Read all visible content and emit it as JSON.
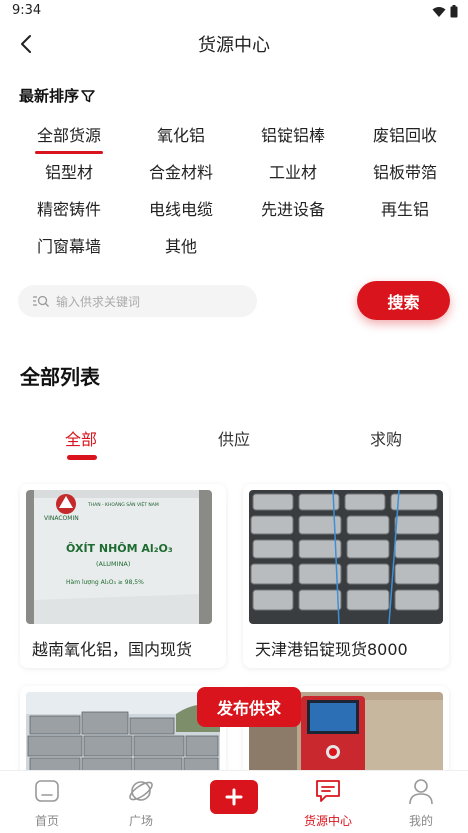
{
  "status_bar": {
    "time": "9:34",
    "icons": [
      "wifi-icon",
      "battery-icon"
    ]
  },
  "header": {
    "title": "货源中心"
  },
  "sort": {
    "label": "最新排序",
    "icon": "filter-icon"
  },
  "categories": [
    {
      "label": "全部货源",
      "active": true
    },
    {
      "label": "氧化铝"
    },
    {
      "label": "铝锭铝棒"
    },
    {
      "label": "废铝回收"
    },
    {
      "label": "铝型材"
    },
    {
      "label": "合金材料"
    },
    {
      "label": "工业材"
    },
    {
      "label": "铝板带箔"
    },
    {
      "label": "精密铸件"
    },
    {
      "label": "电线电缆"
    },
    {
      "label": "先进设备"
    },
    {
      "label": "再生铝"
    },
    {
      "label": "门窗幕墙"
    },
    {
      "label": "其他"
    }
  ],
  "search": {
    "placeholder": "输入供求关键词",
    "button_label": "搜索"
  },
  "list": {
    "section_title": "全部列表",
    "tabs": [
      {
        "label": "全部",
        "active": true
      },
      {
        "label": "供应"
      },
      {
        "label": "求购"
      }
    ],
    "cards": [
      {
        "title": "越南氧化铝，国内现货",
        "image_text": [
          "VINACOMIN",
          "THAN - KHOÁNG SẢN VIỆT NAM",
          "ÔXÍT NHÔM Al₂O₃",
          "(ALUMINA)",
          "Hàm lượng Al₂O₃ ≥ 98,5%"
        ]
      },
      {
        "title": "天津港铝锭现货8000"
      },
      {
        "title": ""
      },
      {
        "title": ""
      }
    ]
  },
  "publish": {
    "label": "发布供求"
  },
  "bottom_nav": [
    {
      "label": "首页",
      "icon": "home-icon"
    },
    {
      "label": "广场",
      "icon": "planet-icon"
    },
    {
      "label": "",
      "icon": "add-icon"
    },
    {
      "label": "货源中心",
      "icon": "message-icon",
      "active": true
    },
    {
      "label": "我的",
      "icon": "user-icon"
    }
  ],
  "colors": {
    "accent": "#d9141c",
    "text": "#222222",
    "muted": "#888888"
  }
}
